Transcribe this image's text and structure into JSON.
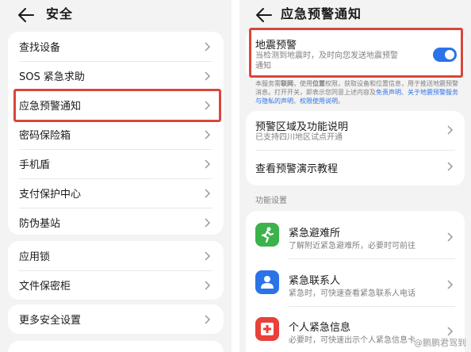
{
  "left": {
    "title": "安全",
    "group1": [
      "查找设备",
      "SOS 紧急求助",
      "应急预警通知",
      "密码保险箱",
      "手机盾",
      "支付保护中心",
      "防伪基站"
    ],
    "group2": [
      "应用锁",
      "文件保密柜"
    ],
    "group3": [
      "更多安全设置"
    ]
  },
  "right": {
    "title": "应急预警通知",
    "quake": {
      "title": "地震预警",
      "desc1": "当检测到地震时，及时向您发送地震预警",
      "desc2": "通知",
      "enabled": true
    },
    "notice": {
      "p1": "本服务需",
      "b1": "联网",
      "p2": "，使用",
      "b2": "位置",
      "p3": "权限，获取设备和位置信息，用于推送地震预警",
      "line2a": "消息。打开开关，即表示您同意上述内容及",
      "l1": "免责声明",
      "line2b": "、",
      "l2": "关于地震预警服务",
      "line3a": "与隐私的声明",
      "line3b": "、",
      "l3": "权限使用说明",
      "line3c": "。"
    },
    "area": {
      "title": "预警区域及功能说明",
      "sub": "已支持四川地区试点开通"
    },
    "demo": {
      "title": "查看预警演示教程"
    },
    "section": "功能设置",
    "features": [
      {
        "title": "紧急避难所",
        "sub": "了解附近紧急避难所，必要时可前往",
        "icon": "running-person-icon",
        "color": "#3cb34a"
      },
      {
        "title": "紧急联系人",
        "sub": "紧急时，可快速查看紧急联系人电话",
        "icon": "contact-person-icon",
        "color": "#2c73e8"
      },
      {
        "title": "个人紧急信息",
        "sub": "必要时，可快速出示个人紧急信息卡",
        "icon": "medical-cross-icon",
        "color": "#e8413a"
      }
    ]
  },
  "watermark": "@鹏鹏君驾到",
  "colors": {
    "highlight": "#d9463c",
    "toggle_on": "#2c73e8"
  }
}
